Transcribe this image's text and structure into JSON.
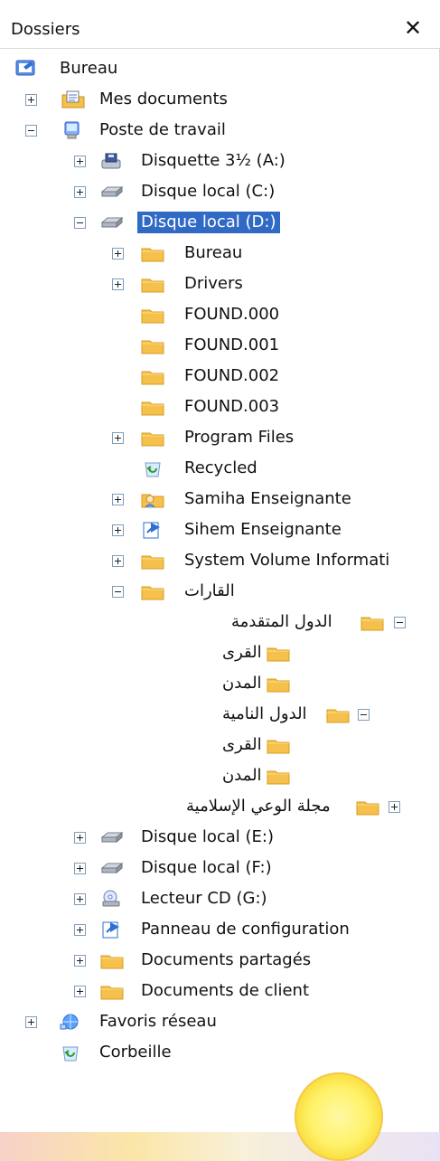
{
  "panel": {
    "title": "Dossiers",
    "close_symbol": "✕"
  },
  "tree": {
    "items": [
      {
        "label": "Bureau",
        "icon": "desktop-icon",
        "expander": "none"
      },
      {
        "label": "Mes documents",
        "icon": "my-documents-icon",
        "expander": "plus"
      },
      {
        "label": "Poste de travail",
        "icon": "computer-icon",
        "expander": "minus"
      },
      {
        "label": "Disquette 3½ (A:)",
        "icon": "floppy-drive-icon",
        "expander": "plus"
      },
      {
        "label": "Disque local (C:)",
        "icon": "hard-drive-icon",
        "expander": "plus"
      },
      {
        "label": "Disque local (D:)",
        "icon": "hard-drive-icon",
        "expander": "minus",
        "selected": true
      },
      {
        "label": "Bureau",
        "icon": "folder-icon",
        "expander": "plus"
      },
      {
        "label": "Drivers",
        "icon": "folder-icon",
        "expander": "plus"
      },
      {
        "label": "FOUND.000",
        "icon": "folder-icon",
        "expander": "none"
      },
      {
        "label": "FOUND.001",
        "icon": "folder-icon",
        "expander": "none"
      },
      {
        "label": "FOUND.002",
        "icon": "folder-icon",
        "expander": "none"
      },
      {
        "label": "FOUND.003",
        "icon": "folder-icon",
        "expander": "none"
      },
      {
        "label": "Program Files",
        "icon": "folder-icon",
        "expander": "plus"
      },
      {
        "label": "Recycled",
        "icon": "recycle-bin-icon",
        "expander": "none"
      },
      {
        "label": "Samiha Enseignante",
        "icon": "user-folder-icon",
        "expander": "plus"
      },
      {
        "label": "Sihem Enseignante",
        "icon": "user-folder-icon",
        "expander": "plus"
      },
      {
        "label": "System Volume Informati",
        "icon": "folder-icon",
        "expander": "plus"
      },
      {
        "label": "القارات",
        "icon": "folder-icon",
        "expander": "minus",
        "rtl": true
      },
      {
        "label": "الدول المتقدمة",
        "icon": "folder-icon",
        "expander": "minus",
        "rtl": true
      },
      {
        "label": "القرى",
        "icon": "folder-icon",
        "expander": "none",
        "rtl": true
      },
      {
        "label": "المدن",
        "icon": "folder-icon",
        "expander": "none",
        "rtl": true
      },
      {
        "label": "الدول النامية",
        "icon": "folder-icon",
        "expander": "minus",
        "rtl": true
      },
      {
        "label": "القرى",
        "icon": "folder-icon",
        "expander": "none",
        "rtl": true
      },
      {
        "label": "المدن",
        "icon": "folder-icon",
        "expander": "none",
        "rtl": true
      },
      {
        "label": "مجلة الوعي الإسلامية",
        "icon": "folder-icon",
        "expander": "plus",
        "rtl": true
      },
      {
        "label": "Disque local (E:)",
        "icon": "hard-drive-icon",
        "expander": "plus"
      },
      {
        "label": "Disque local (F:)",
        "icon": "hard-drive-icon",
        "expander": "plus"
      },
      {
        "label": "Lecteur CD (G:)",
        "icon": "cd-drive-icon",
        "expander": "plus"
      },
      {
        "label": "Panneau de configuration",
        "icon": "control-panel-icon",
        "expander": "plus"
      },
      {
        "label": "Documents partagés",
        "icon": "folder-icon",
        "expander": "plus"
      },
      {
        "label": "Documents de client",
        "icon": "folder-icon",
        "expander": "plus"
      },
      {
        "label": "Favoris réseau",
        "icon": "network-places-icon",
        "expander": "plus"
      },
      {
        "label": "Corbeille",
        "icon": "recycle-bin-icon",
        "expander": "none"
      }
    ]
  },
  "colors": {
    "selection": "#316ac5",
    "folder": "#f5c04b",
    "folder_dark": "#d89c22"
  }
}
